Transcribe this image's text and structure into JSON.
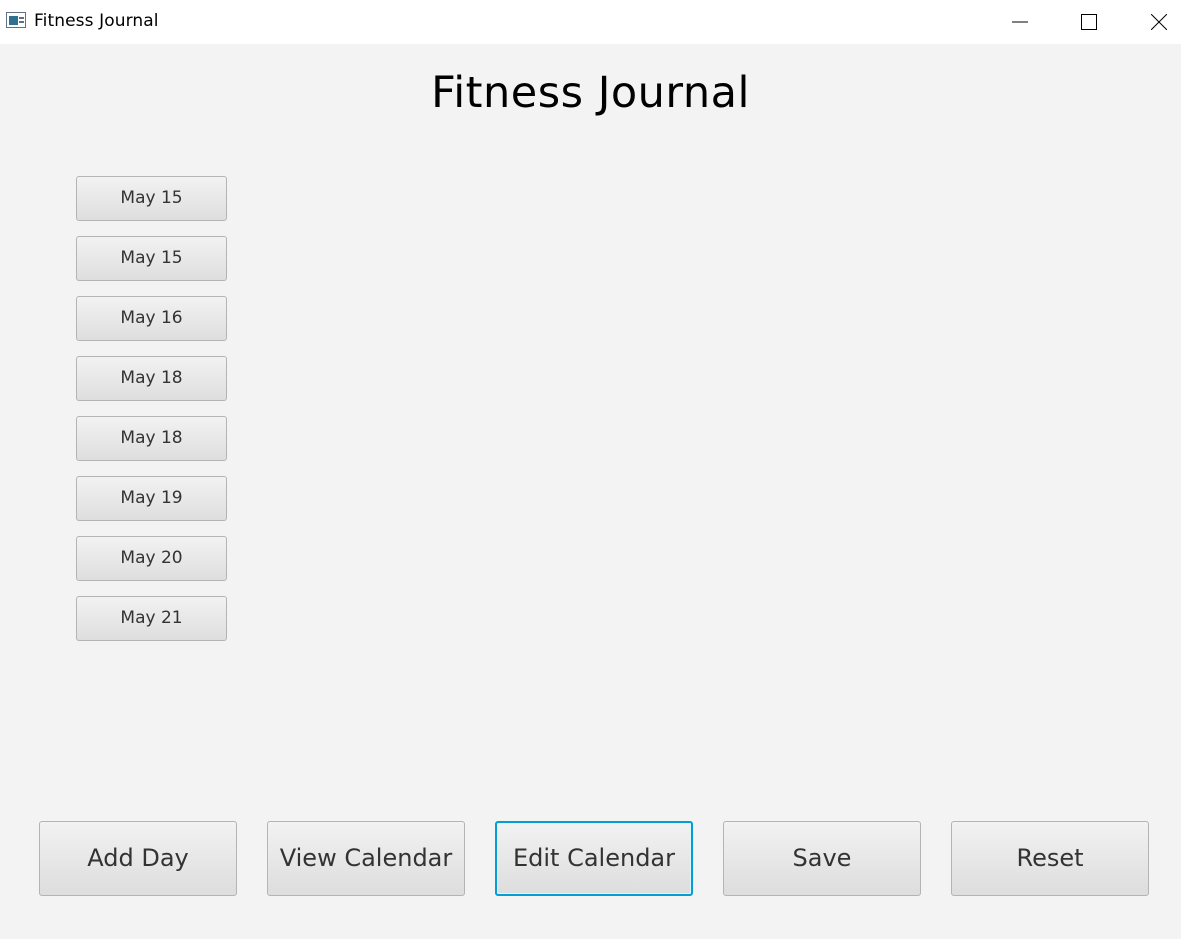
{
  "window": {
    "title": "Fitness Journal",
    "icon": "app-window-icon"
  },
  "main": {
    "heading": "Fitness Journal"
  },
  "days": [
    {
      "label": "May 15"
    },
    {
      "label": "May 15"
    },
    {
      "label": "May 16"
    },
    {
      "label": "May 18"
    },
    {
      "label": "May 18"
    },
    {
      "label": "May 19"
    },
    {
      "label": "May 20"
    },
    {
      "label": "May 21"
    }
  ],
  "actions": {
    "add_day": "Add Day",
    "view_calendar": "View Calendar",
    "edit_calendar": "Edit Calendar",
    "save": "Save",
    "reset": "Reset"
  },
  "colors": {
    "background": "#f3f3f3",
    "focus_border": "#039ed3"
  }
}
